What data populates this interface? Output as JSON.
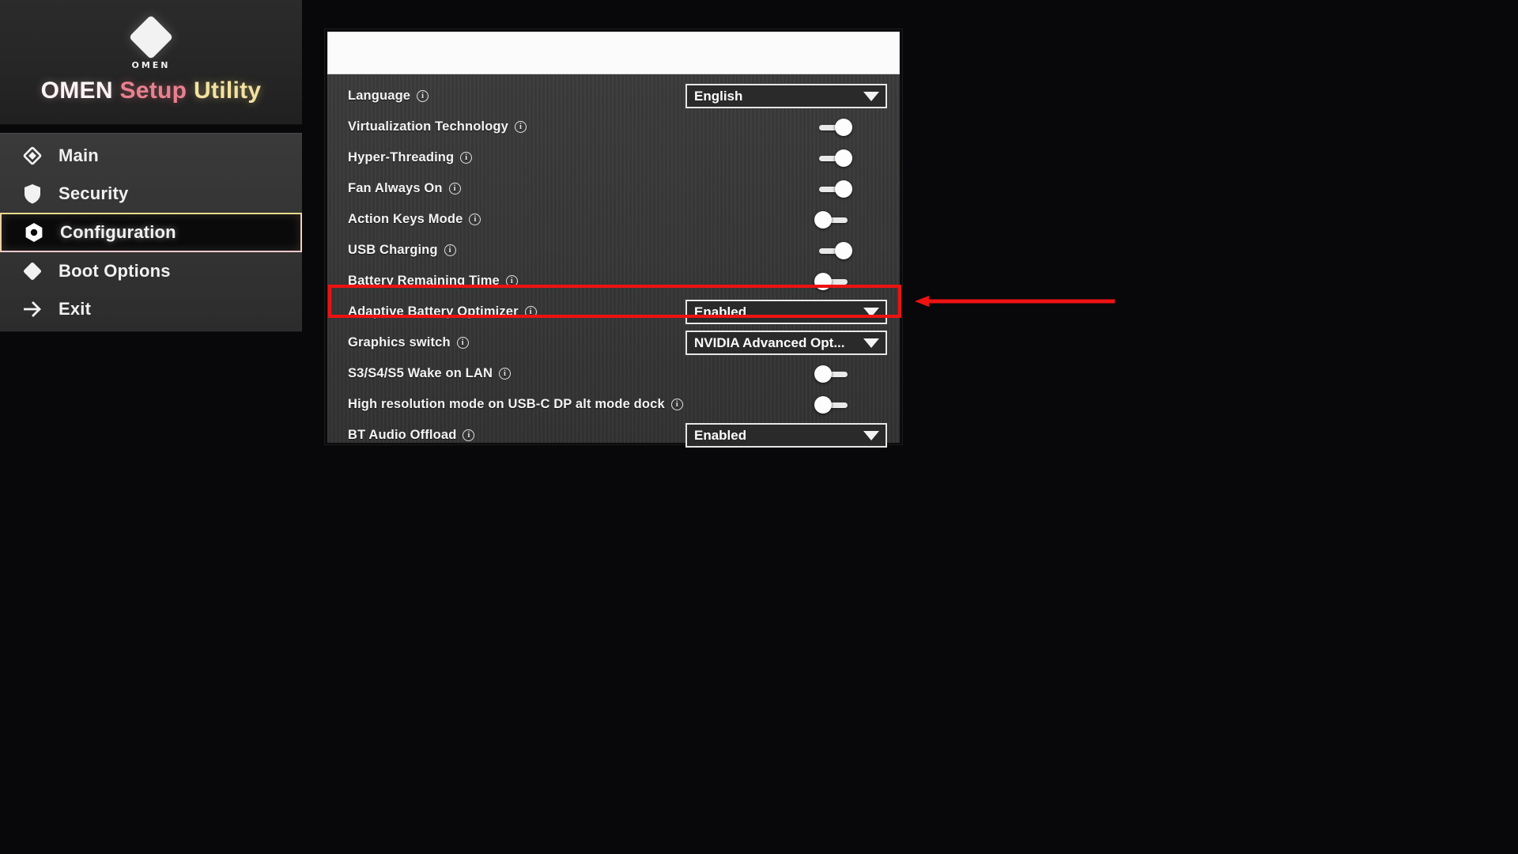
{
  "brand": {
    "logo_icon": "omen-diamond-icon",
    "logo_wordmark": "OMEN",
    "title_part1": "OMEN ",
    "title_part2": "Setup ",
    "title_part3": "Utility",
    "colors": {
      "part1": "#fdf4f6",
      "part2": "#e8818e",
      "part3": "#f3e2a0"
    }
  },
  "sidebar": {
    "items": [
      {
        "label": "Main",
        "icon": "diamond-outline-icon",
        "selected": false
      },
      {
        "label": "Security",
        "icon": "shield-icon",
        "selected": false
      },
      {
        "label": "Configuration",
        "icon": "hexagon-gear-icon",
        "selected": true
      },
      {
        "label": "Boot Options",
        "icon": "diamond-filled-icon",
        "selected": false
      },
      {
        "label": "Exit",
        "icon": "arrow-right-icon",
        "selected": false
      }
    ]
  },
  "panel": {
    "header_text": "",
    "rows": [
      {
        "label": "Language",
        "info_icon": "info-icon",
        "control": "dropdown",
        "value": "English",
        "highlighted": false
      },
      {
        "label": "Virtualization Technology",
        "info_icon": "info-icon",
        "control": "toggle",
        "value": "on",
        "highlighted": false
      },
      {
        "label": "Hyper-Threading",
        "info_icon": "info-icon",
        "control": "toggle",
        "value": "on",
        "highlighted": false
      },
      {
        "label": "Fan Always On",
        "info_icon": "info-icon",
        "control": "toggle",
        "value": "on",
        "highlighted": false
      },
      {
        "label": "Action Keys Mode",
        "info_icon": "info-icon",
        "control": "toggle",
        "value": "off",
        "highlighted": false
      },
      {
        "label": "USB Charging",
        "info_icon": "info-icon",
        "control": "toggle",
        "value": "on",
        "highlighted": false
      },
      {
        "label": "Battery Remaining Time",
        "info_icon": "info-icon",
        "control": "toggle",
        "value": "off",
        "highlighted": false
      },
      {
        "label": "Adaptive Battery Optimizer",
        "info_icon": "info-icon",
        "control": "dropdown",
        "value": "Enabled",
        "highlighted": true
      },
      {
        "label": "Graphics switch",
        "info_icon": "info-icon",
        "control": "dropdown",
        "value": "NVIDIA Advanced Opt...",
        "highlighted": false
      },
      {
        "label": "S3/S4/S5 Wake on LAN",
        "info_icon": "info-icon",
        "control": "toggle",
        "value": "off",
        "highlighted": false
      },
      {
        "label": "High resolution mode on USB-C DP alt mode dock",
        "info_icon": "info-icon",
        "control": "toggle",
        "value": "off",
        "highlighted": false
      },
      {
        "label": "BT Audio Offload",
        "info_icon": "info-icon",
        "control": "dropdown",
        "value": "Enabled",
        "highlighted": false
      }
    ]
  },
  "annotations": {
    "highlight_color": "#ee1212",
    "arrow_icon": "arrow-left-icon",
    "arrow_color": "#ee1212",
    "info_glyph": "i"
  }
}
